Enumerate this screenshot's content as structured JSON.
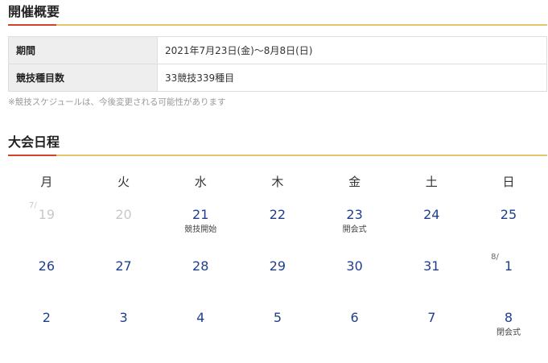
{
  "overview": {
    "title": "開催概要",
    "rows": [
      {
        "label": "期間",
        "value": "2021年7月23日(金)〜8月8日(日)"
      },
      {
        "label": "競技種目数",
        "value": "33競技339種目"
      }
    ],
    "note": "※競技スケジュールは、今後変更される可能性があります"
  },
  "schedule": {
    "title": "大会日程",
    "weekdays": [
      "月",
      "火",
      "水",
      "木",
      "金",
      "土",
      "日"
    ],
    "weeks": [
      [
        {
          "prefix": "7/",
          "day": "19",
          "past": true,
          "event": ""
        },
        {
          "prefix": "",
          "day": "20",
          "past": true,
          "event": ""
        },
        {
          "prefix": "",
          "day": "21",
          "past": false,
          "event": "競技開始"
        },
        {
          "prefix": "",
          "day": "22",
          "past": false,
          "event": ""
        },
        {
          "prefix": "",
          "day": "23",
          "past": false,
          "event": "開会式"
        },
        {
          "prefix": "",
          "day": "24",
          "past": false,
          "event": ""
        },
        {
          "prefix": "",
          "day": "25",
          "past": false,
          "event": ""
        }
      ],
      [
        {
          "prefix": "",
          "day": "26",
          "past": false,
          "event": ""
        },
        {
          "prefix": "",
          "day": "27",
          "past": false,
          "event": ""
        },
        {
          "prefix": "",
          "day": "28",
          "past": false,
          "event": ""
        },
        {
          "prefix": "",
          "day": "29",
          "past": false,
          "event": ""
        },
        {
          "prefix": "",
          "day": "30",
          "past": false,
          "event": ""
        },
        {
          "prefix": "",
          "day": "31",
          "past": false,
          "event": ""
        },
        {
          "prefix": "8/",
          "day": "1",
          "past": false,
          "event": ""
        }
      ],
      [
        {
          "prefix": "",
          "day": "2",
          "past": false,
          "event": ""
        },
        {
          "prefix": "",
          "day": "3",
          "past": false,
          "event": ""
        },
        {
          "prefix": "",
          "day": "4",
          "past": false,
          "event": ""
        },
        {
          "prefix": "",
          "day": "5",
          "past": false,
          "event": ""
        },
        {
          "prefix": "",
          "day": "6",
          "past": false,
          "event": ""
        },
        {
          "prefix": "",
          "day": "7",
          "past": false,
          "event": ""
        },
        {
          "prefix": "",
          "day": "8",
          "past": false,
          "event": "閉会式"
        }
      ]
    ]
  },
  "colors": {
    "title_rule": "#e4c56a",
    "title_accent": "#d0432c",
    "date_link": "#1f3f8e",
    "date_past": "#c8c8c8",
    "header_cell_bg": "#eeeeee"
  }
}
